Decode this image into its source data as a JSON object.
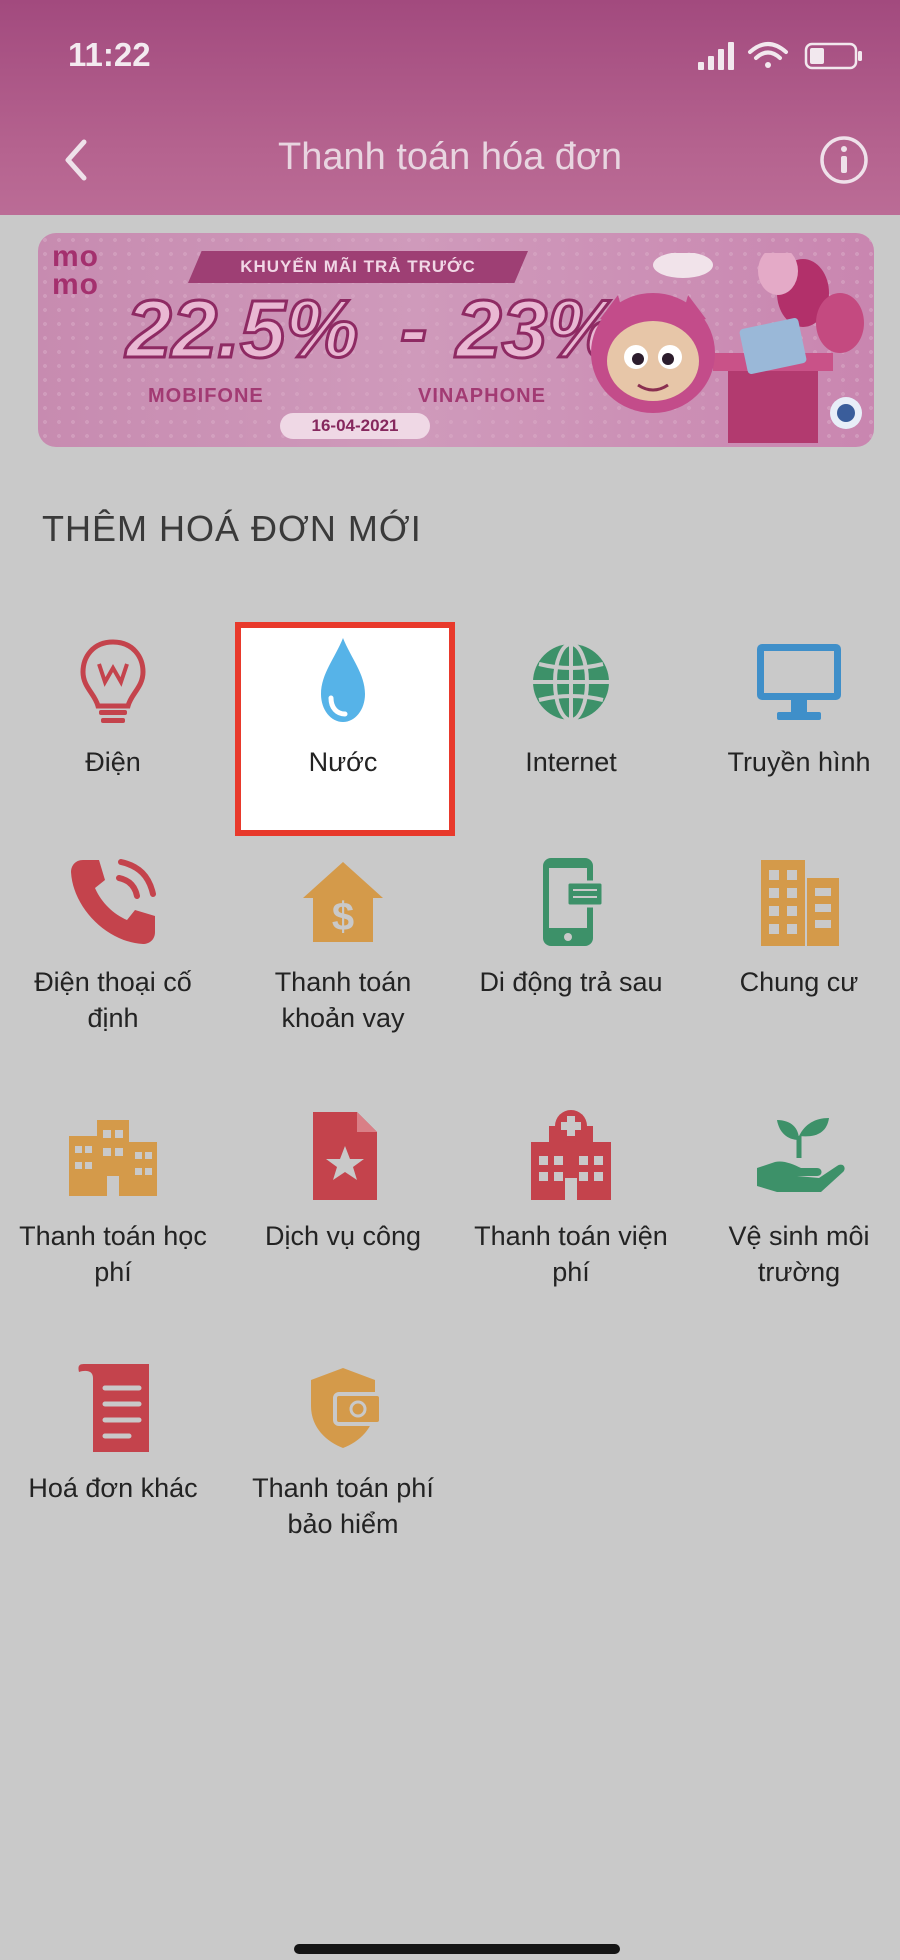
{
  "status_bar": {
    "time": "11:22"
  },
  "header": {
    "title": "Thanh toán hóa đơn"
  },
  "banner": {
    "logo_top": "mo",
    "logo_bottom": "mo",
    "ribbon": "KHUYẾN MÃI TRẢ TRƯỚC",
    "left_percent": "22.5%",
    "dash": "-",
    "right_percent": "23%",
    "left_carrier": "MOBIFONE",
    "right_carrier": "VINAPHONE",
    "date": "16-04-2021"
  },
  "section": {
    "title": "THÊM HOÁ ĐƠN MỚI"
  },
  "tiles": [
    {
      "label": "Điện",
      "icon": "lightbulb-icon"
    },
    {
      "label": "Nước",
      "icon": "water-drop-icon"
    },
    {
      "label": "Internet",
      "icon": "globe-icon"
    },
    {
      "label": "Truyền hình",
      "icon": "monitor-icon"
    },
    {
      "label": "Điện thoại cố định",
      "icon": "phone-icon"
    },
    {
      "label": "Thanh toán khoản vay",
      "icon": "house-dollar-icon"
    },
    {
      "label": "Di động trả sau",
      "icon": "mobile-icon"
    },
    {
      "label": "Chung cư",
      "icon": "apartment-icon"
    },
    {
      "label": "Thanh toán học phí",
      "icon": "school-building-icon"
    },
    {
      "label": "Dịch vụ công",
      "icon": "document-star-icon"
    },
    {
      "label": "Thanh toán viện phí",
      "icon": "hospital-icon"
    },
    {
      "label": "Vệ sinh môi trường",
      "icon": "plant-hand-icon"
    },
    {
      "label": "Hoá đơn khác",
      "icon": "receipt-icon"
    },
    {
      "label": "Thanh toán phí bảo hiểm",
      "icon": "shield-money-icon"
    }
  ],
  "colors": {
    "header": "#a24a7e",
    "overlay_bg": "#c9c9c9",
    "highlight_border": "#e8392b",
    "icon_red": "#c4434c",
    "icon_orange": "#d49a4a",
    "icon_green": "#3d9169",
    "icon_blue": "#3f8fc9"
  }
}
